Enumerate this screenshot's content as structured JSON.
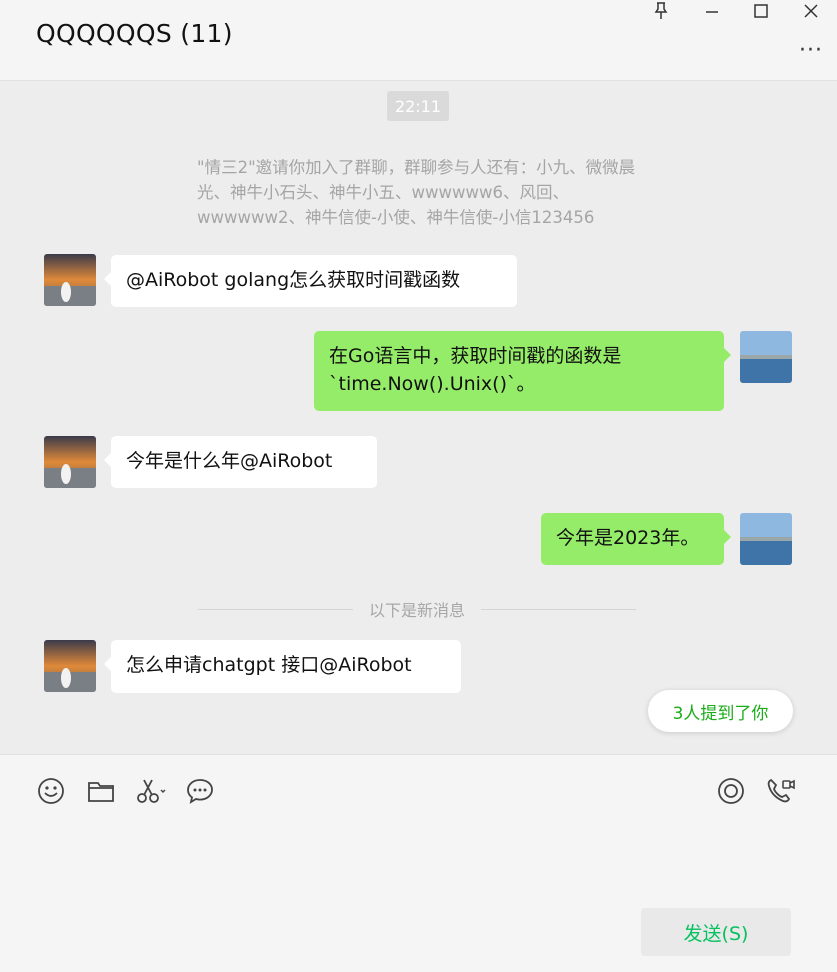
{
  "header": {
    "title": "QQQQQQS (11)",
    "more_label": "···"
  },
  "chat": {
    "time_chip": "22:11",
    "system_message": "\"情三2\"邀请你加入了群聊，群聊参与人还有：小九、微微晨光、神牛小石头、神牛小五、wwwwww6、风回、wwwwww2、神牛信使-小使、神牛信使-小信123456",
    "messages": [
      {
        "side": "in",
        "text": "@AiRobot  golang怎么获取时间戳函数"
      },
      {
        "side": "out",
        "text": "在Go语言中，获取时间戳的函数是`time.Now().Unix()`。"
      },
      {
        "side": "in",
        "text": "今年是什么年@AiRobot"
      },
      {
        "side": "out",
        "text": "今年是2023年。"
      },
      {
        "side": "in",
        "text": "怎么申请chatgpt 接口@AiRobot"
      }
    ],
    "new_messages_divider": "以下是新消息",
    "mention_pill": "3人提到了你"
  },
  "input": {
    "send_label": "发送(S)"
  },
  "colors": {
    "out_bubble": "#95ec69",
    "in_bubble": "#ffffff",
    "accent_green": "#07c160"
  },
  "icons": [
    "pin-icon",
    "minimize-icon",
    "maximize-icon",
    "close-icon",
    "more-icon",
    "emoji-icon",
    "folder-icon",
    "scissors-icon",
    "chat-history-icon",
    "live-icon",
    "video-call-icon"
  ]
}
